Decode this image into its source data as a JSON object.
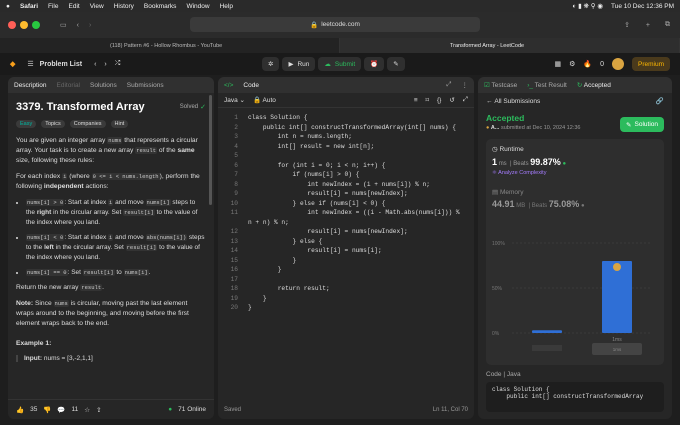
{
  "macbar": {
    "apple": "",
    "app": "Safari",
    "menus": [
      "File",
      "Edit",
      "View",
      "History",
      "Bookmarks",
      "Window",
      "Help"
    ],
    "datetime": "Tue 10 Dec 12:36 PM"
  },
  "safari": {
    "url": "leetcode.com"
  },
  "tabs": [
    {
      "label": "(118) Pattern #6 - Hollow Rhombus - YouTube"
    },
    {
      "label": "Transformed Array - LeetCode"
    }
  ],
  "lc": {
    "problem_list": "Problem List",
    "run": "Run",
    "submit": "Submit",
    "premium": "Premium",
    "streak": "0"
  },
  "left": {
    "tabs": [
      "Description",
      "Editorial",
      "Solutions",
      "Submissions"
    ],
    "title": "3379. Transformed Array",
    "solved": "Solved",
    "tags": [
      "Easy",
      "Topics",
      "Companies",
      "Hint"
    ],
    "p1a": "You are given an integer array ",
    "p1b": " that represents a circular array. Your task is to create a new array ",
    "p1c": " of the ",
    "p1d": "same",
    "p1e": " size, following these rules:",
    "nums": "nums",
    "result": "result",
    "p2a": "For each index ",
    "p2b": " (where ",
    "p2c": "), perform the following ",
    "p2d": "independent",
    "p2e": " actions:",
    "i": "i",
    "range": "0 <= i < nums.length",
    "b1a": "nums[i] > 0",
    "b1b": ": Start at index ",
    "b1c": " and move ",
    "b1d": "nums[i]",
    "b1e": " steps to the ",
    "b1f": "right",
    "b1g": " in the circular array. Set ",
    "b1h": "result[i]",
    "b1i": " to the value of the index where you land.",
    "b2a": "nums[i] < 0",
    "b2b": ": Start at index ",
    "b2c": " and move ",
    "b2d": "abs(nums[i])",
    "b2e": " steps to the ",
    "b2f": "left",
    "b2g": " in the circular array. Set ",
    "b2h": "result[i]",
    "b2i": " to the value of the index where you land.",
    "b3a": "nums[i] == 0",
    "b3b": ": Set ",
    "b3c": "result[i]",
    "b3d": " to ",
    "b3e": "nums[i]",
    "b3f": ".",
    "ret": "Return the new array ",
    "ret2": ".",
    "note_a": "Note:",
    "note_b": " Since ",
    "note_c": " is circular, moving past the last element wraps around to the beginning, and moving before the first element wraps back to the end.",
    "ex": "Example 1:",
    "input_lbl": "Input:",
    "input_val": " nums = [3,-2,1,1]",
    "likes": "35",
    "comments": "11",
    "online": "71 Online"
  },
  "code": {
    "title": "Code",
    "lang": "Java",
    "auto": "Auto",
    "saved": "Saved",
    "pos": "Ln 11, Col 70",
    "lines": [
      "class Solution {",
      "    public int[] constructTransformedArray(int[] nums) {",
      "        int n = nums.length;",
      "        int[] result = new int[n];",
      "",
      "        for (int i = 0; i < n; i++) {",
      "            if (nums[i] > 0) {",
      "                int newIndex = (i + nums[i]) % n;",
      "                result[i] = nums[newIndex];",
      "            } else if (nums[i] < 0) {",
      "                int newIndex = ((i - Math.abs(nums[i])) %",
      "n + n) % n;",
      "                result[i] = nums[newIndex];",
      "            } else {",
      "                result[i] = nums[i];",
      "            }",
      "        }",
      "",
      "        return result;",
      "    }",
      "}",
      ""
    ],
    "numbers": [
      "1",
      "2",
      "3",
      "4",
      "5",
      "6",
      "7",
      "8",
      "9",
      "10",
      "11",
      "",
      "12",
      "13",
      "14",
      "15",
      "16",
      "17",
      "18",
      "19",
      "20",
      ""
    ]
  },
  "right": {
    "tabs": [
      "Testcase",
      "Test Result",
      "Accepted"
    ],
    "all": "All Submissions",
    "accepted": "Accepted",
    "user": "A...",
    "submitted": "submitted at Dec 10, 2024 12:36",
    "solution": "Solution",
    "runtime": "Runtime",
    "rt_val": "1",
    "rt_unit": "ms",
    "beats": "Beats",
    "rt_beats": "99.87%",
    "analyze": "Analyze Complexity",
    "memory": "Memory",
    "mem_val": "44.91",
    "mem_unit": "MB",
    "mem_beats": "75.08%",
    "ticks": [
      "100%",
      "50%",
      "0%"
    ],
    "xlabel": "1ms",
    "xlabel2": "1ms",
    "code_lbl": "Code",
    "java": "Java",
    "snip1": "class Solution {",
    "snip2": "    public int[] constructTransformedArray"
  },
  "chart_data": {
    "type": "bar",
    "categories": [
      "",
      "1ms"
    ],
    "values": [
      3,
      80
    ],
    "ylim": [
      0,
      100
    ],
    "yticks": [
      "100%",
      "50%",
      "0%"
    ],
    "highlight": "1ms",
    "color": "#2f6fd6"
  }
}
